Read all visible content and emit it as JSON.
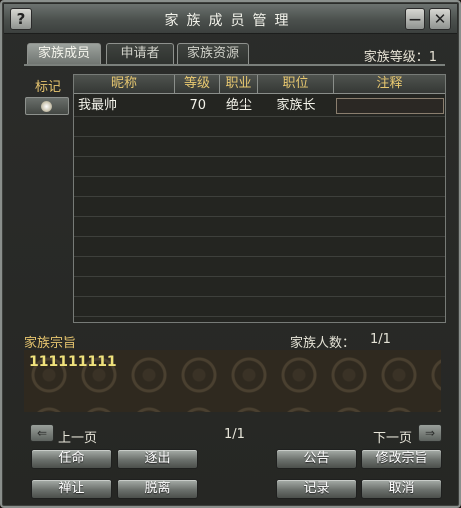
{
  "window": {
    "title": "家族成员管理",
    "help_glyph": "?",
    "minimize_glyph": "—",
    "close_glyph": "✕"
  },
  "tabs": [
    {
      "label": "家族成员",
      "active": true
    },
    {
      "label": "申请者",
      "active": false
    },
    {
      "label": "家族资源",
      "active": false
    }
  ],
  "family_level": "家族等级：1",
  "mark_header": "标记",
  "table": {
    "headers": [
      "昵称",
      "等级",
      "职业",
      "职位",
      "注释"
    ],
    "rows": [
      {
        "name": "我最帅",
        "level": "70",
        "class": "绝尘",
        "position": "家族长",
        "note": ""
      }
    ]
  },
  "motto_label": "家族宗旨",
  "member_count_label": "家族人数：",
  "member_count": "1/1",
  "motto_text": "111111111",
  "pager": {
    "prev_label": "上一页",
    "next_label": "下一页",
    "page": "1/1",
    "prev_arrow": "⇐",
    "next_arrow": "⇒"
  },
  "buttons": {
    "appoint": "任命",
    "expel": "逐出",
    "announce": "公告",
    "edit_motto": "修改宗旨",
    "abdicate": "禅让",
    "leave": "脱离",
    "log": "记录",
    "cancel": "取消"
  },
  "colors": {
    "header_text": "#e8c870",
    "motto_text": "#f0e27c",
    "panel_bg": "#262724"
  }
}
